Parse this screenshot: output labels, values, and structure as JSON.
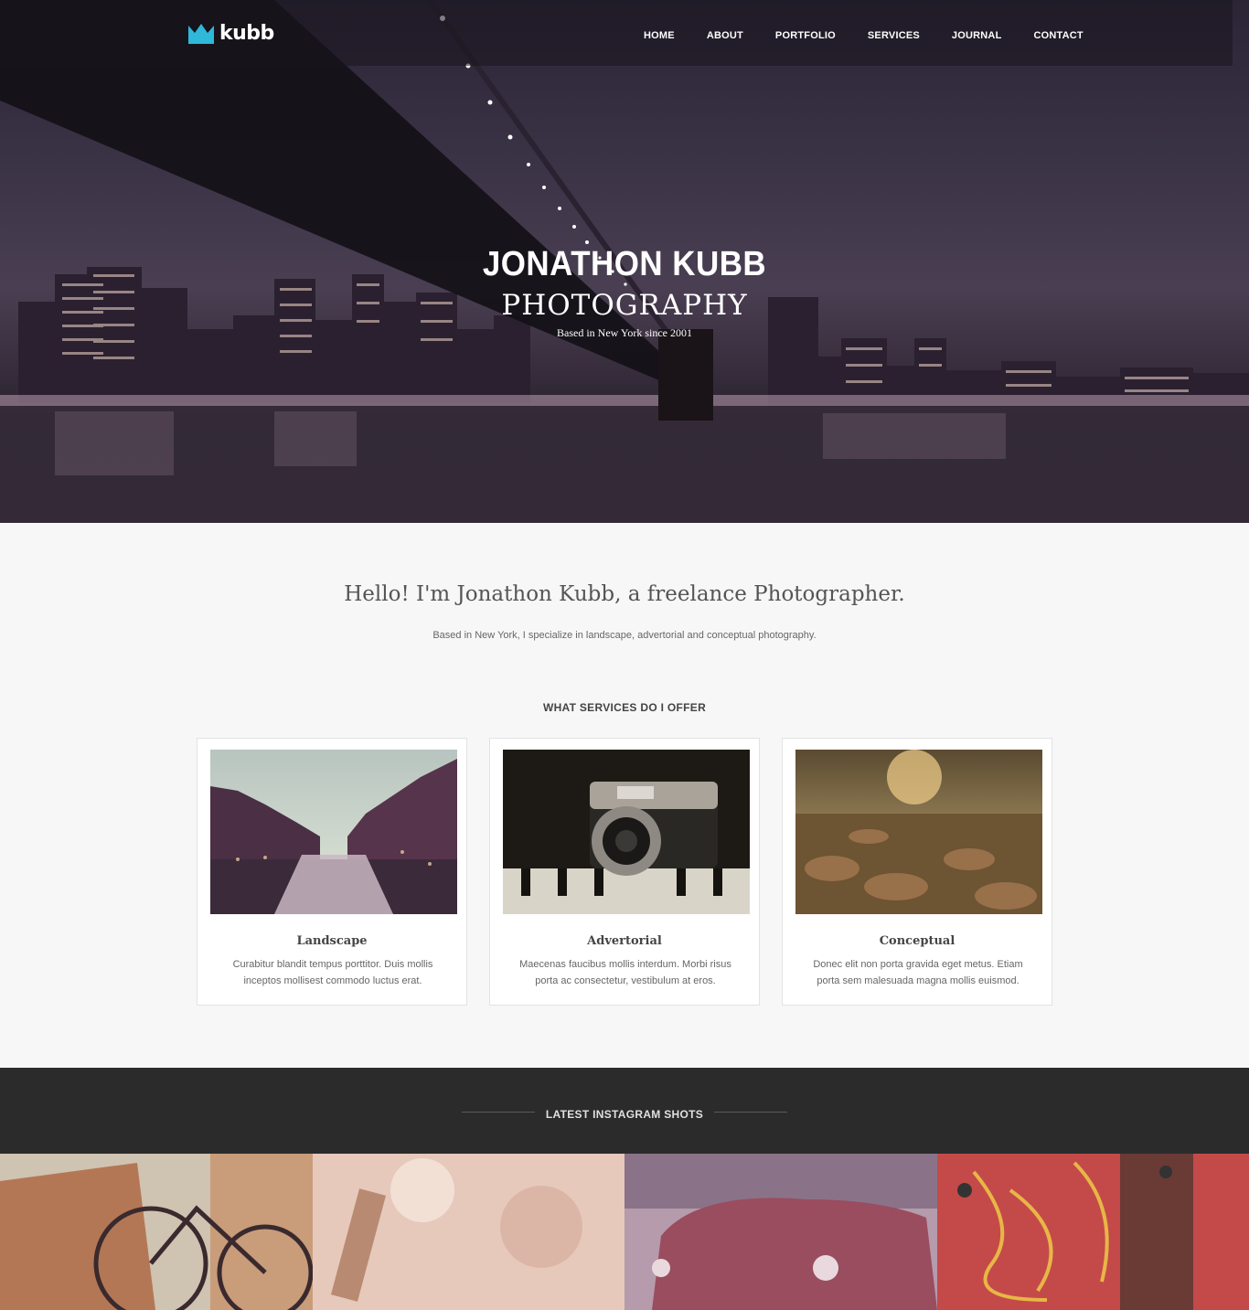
{
  "header": {
    "brand": "kubb",
    "logo_icon": "crown-icon",
    "accent_color": "#2fb8d9",
    "nav": [
      {
        "label": "HOME"
      },
      {
        "label": "ABOUT"
      },
      {
        "label": "PORTFOLIO"
      },
      {
        "label": "SERVICES"
      },
      {
        "label": "JOURNAL"
      },
      {
        "label": "CONTACT"
      }
    ]
  },
  "hero": {
    "title": "JONATHON KUBB",
    "subtitle": "PHOTOGRAPHY",
    "tagline": "Based in New York since 2001"
  },
  "about": {
    "heading": "Hello! I'm Jonathon Kubb, a freelance Photographer.",
    "text": "Based in New York, I specialize in landscape, advertorial and conceptual photography."
  },
  "services": {
    "heading": "WHAT SERVICES DO I OFFER",
    "items": [
      {
        "title": "Landscape",
        "description": "Curabitur blandit tempus porttitor. Duis mollis inceptos mollisest commodo luctus erat."
      },
      {
        "title": "Advertorial",
        "description": "Maecenas faucibus mollis interdum. Morbi risus porta ac consectetur, vestibulum at eros."
      },
      {
        "title": "Conceptual",
        "description": "Donec elit non porta gravida eget metus. Etiam porta sem malesuada magna mollis euismod."
      }
    ]
  },
  "instagram": {
    "heading": "LATEST INSTAGRAM SHOTS"
  }
}
